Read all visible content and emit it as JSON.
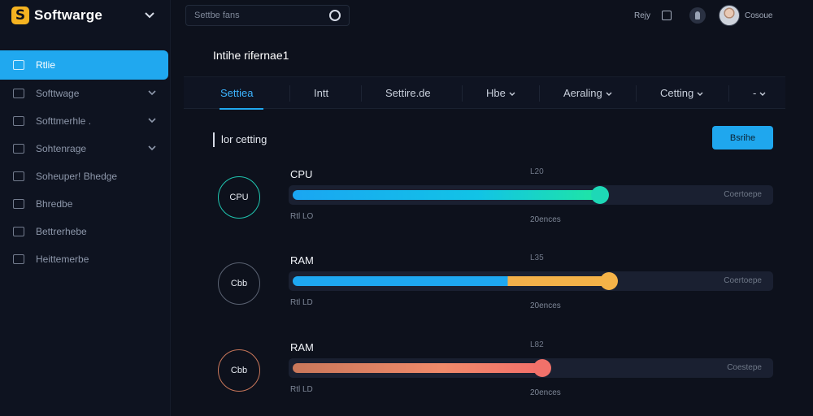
{
  "app": {
    "name": "Softwarge"
  },
  "search": {
    "placeholder": "Settbe fans"
  },
  "topbar": {
    "help": "Rejy",
    "user": "Cosoue"
  },
  "sidebar": {
    "items": [
      {
        "label": "Rtlie",
        "active": true,
        "chevron": false
      },
      {
        "label": "Softtwage",
        "active": false,
        "chevron": true
      },
      {
        "label": "Softtmerhle .",
        "active": false,
        "chevron": true
      },
      {
        "label": "Sohtenrage",
        "active": false,
        "chevron": true
      },
      {
        "label": "Soheuper! Bhedge",
        "active": false,
        "chevron": false
      },
      {
        "label": "Bhredbe",
        "active": false,
        "chevron": false
      },
      {
        "label": "Bettrerhebe",
        "active": false,
        "chevron": false
      },
      {
        "label": "Heittemerbe",
        "active": false,
        "chevron": false
      }
    ]
  },
  "main": {
    "title": "Intihe rifernae1",
    "tabs": [
      {
        "label": "Settiea",
        "active": true,
        "chevron": false
      },
      {
        "label": "Intt",
        "active": false,
        "chevron": false
      },
      {
        "label": "Settire.de",
        "active": false,
        "chevron": false
      },
      {
        "label": "Hbe",
        "active": false,
        "chevron": true
      },
      {
        "label": "Aeraling",
        "active": false,
        "chevron": true
      },
      {
        "label": "Cetting",
        "active": false,
        "chevron": true
      },
      {
        "label": "-",
        "active": false,
        "chevron": true
      }
    ],
    "section_title": "lor cetting",
    "action_button": "Bsrihe",
    "meters": [
      {
        "ring_label": "CPU",
        "label": "CPU",
        "value_top": "L20",
        "track_label": "Coertoepe",
        "sub_left": "Rtl LO",
        "sub_right": "20ences",
        "level": 0.64,
        "fill": "linear-gradient(90deg,#1aa6f2,#12c3e6 60%,#1fe6a4)",
        "knob": "#1ed8b6",
        "ring_color": "#1fc6b0"
      },
      {
        "ring_label": "Cbb",
        "label": "RAM",
        "value_top": "L35",
        "track_label": "Coertoepe",
        "sub_left": "Rtl LD",
        "sub_right": "20ences",
        "level": 0.66,
        "fill": "linear-gradient(90deg,#1ea8f2 0%,#1ea8f2 68%,#f3b04a 68%,#f5b348 100%)",
        "knob": "#f5b348",
        "ring_color": "#5b6373"
      },
      {
        "ring_label": "Cbb",
        "label": "RAM",
        "value_top": "L82",
        "track_label": "Coestepe",
        "sub_left": "Rtl LD",
        "sub_right": "20ences",
        "level": 0.52,
        "fill": "linear-gradient(90deg,#c9775a,#f08a6a 60%,#f36f6a)",
        "knob": "#f1716a",
        "ring_color": "#c9775a"
      }
    ]
  },
  "colors": {
    "accent": "#20a8ef",
    "background": "#0d111c"
  }
}
